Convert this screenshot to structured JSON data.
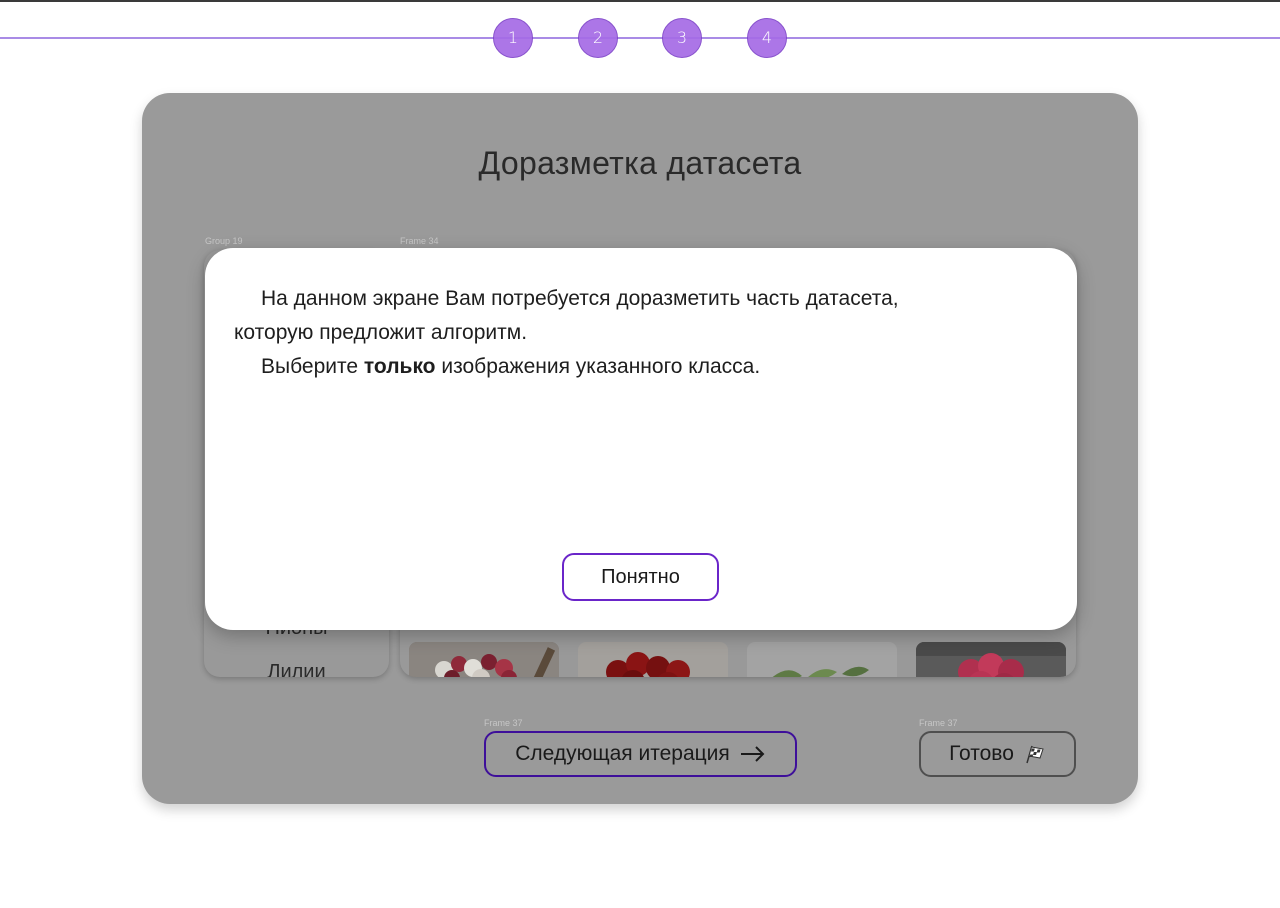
{
  "stepper": {
    "steps": [
      "1",
      "2",
      "3",
      "4"
    ]
  },
  "page": {
    "title": "Доразметка датасета"
  },
  "frame_labels": {
    "group": "Group 19",
    "frame_images": "Frame 34",
    "frame_next": "Frame 37",
    "frame_done": "Frame 37"
  },
  "classes": {
    "partial_item": "Пионы",
    "last_item": "Лилии"
  },
  "buttons": {
    "next_label": "Следующая итерация",
    "next_icon": "arrow-right-icon",
    "done_label": "Готово",
    "done_icon": "checkered-flag-icon"
  },
  "modal": {
    "line1": "На данном экране Вам потребуется доразметить часть датасета,",
    "line2": "которую предложит алгоритм.",
    "line3_before": "Выберите",
    "line3_bold": "только",
    "line3_after": "изображения указанного класса.",
    "ok_label": "Понятно"
  },
  "colors": {
    "accent": "#a56be6",
    "stepper_line": "#a98be6",
    "overlay": "#9a9a9a",
    "next_border": "#3e0f9a",
    "ok_border": "#6a25c9"
  }
}
